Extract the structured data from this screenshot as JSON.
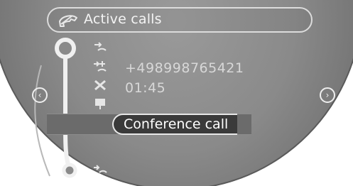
{
  "header": {
    "title": "Active calls"
  },
  "call": {
    "number": "+498998765421",
    "duration": "01:45"
  },
  "menu": {
    "selected_label": "Conference call"
  },
  "icons": {
    "title": "phone-handset-icon",
    "items": [
      "transfer-call-icon",
      "add-call-icon",
      "end-call-icon",
      "microphone-icon",
      "conference-call-icon",
      "keypad-call-icon"
    ],
    "nav_left": "arrow-left-icon",
    "nav_right": "arrow-right-icon"
  },
  "colors": {
    "background": "#8a8a8a",
    "text": "#f4f4f4",
    "highlight": "#3a3a3a"
  }
}
